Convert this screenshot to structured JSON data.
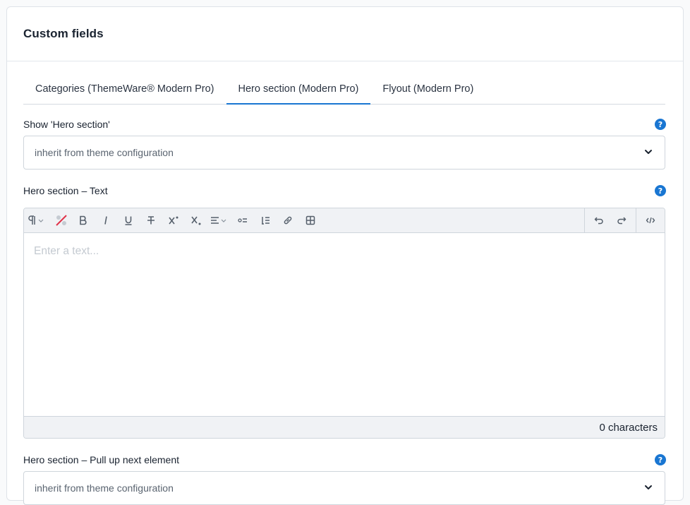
{
  "card": {
    "title": "Custom fields"
  },
  "tabs": [
    {
      "label": "Categories (ThemeWare® Modern Pro)",
      "active": false
    },
    {
      "label": "Hero section (Modern Pro)",
      "active": true
    },
    {
      "label": "Flyout (Modern Pro)",
      "active": false
    }
  ],
  "fields": {
    "show_hero": {
      "label": "Show 'Hero section'",
      "value": "inherit from theme configuration"
    },
    "hero_text": {
      "label": "Hero section – Text",
      "placeholder": "Enter a text...",
      "char_count": "0 characters"
    },
    "pull_up": {
      "label": "Hero section – Pull up next element",
      "value": "inherit from theme configuration"
    }
  },
  "help_glyph": "?",
  "toolbar": {
    "buttons": [
      "paragraph-format",
      "clear-format",
      "bold",
      "italic",
      "underline",
      "strikethrough",
      "superscript",
      "subscript",
      "text-align",
      "bullet-list",
      "numbered-list",
      "link",
      "table",
      "undo",
      "redo",
      "code-view"
    ]
  },
  "colors": {
    "accent": "#1976d2",
    "border": "#cfd5dc",
    "toolbar_bg": "#f0f2f5"
  }
}
